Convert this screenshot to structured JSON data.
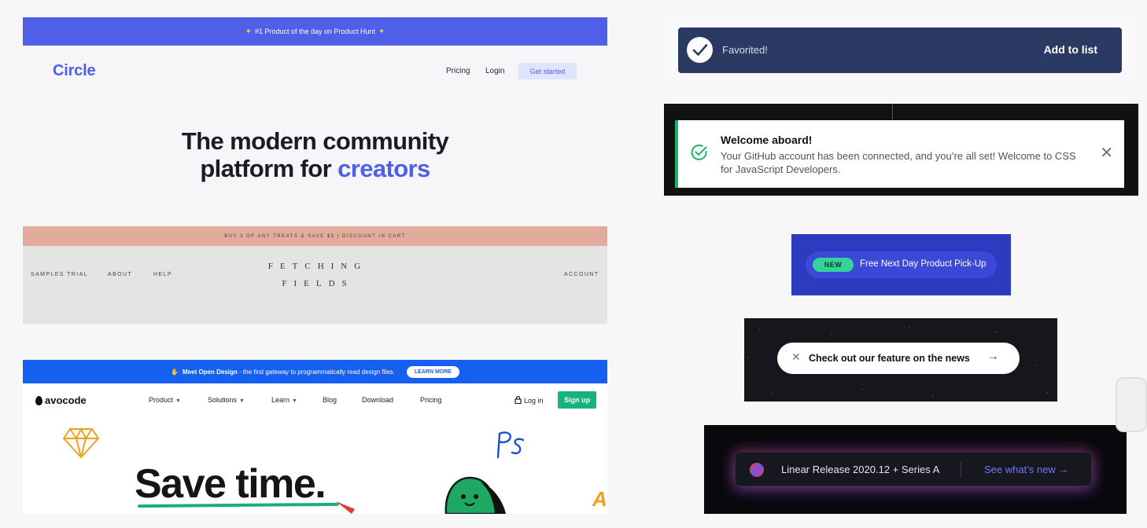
{
  "circle": {
    "banner": "#1 Product of the day on Product Hunt",
    "logo": "Circle",
    "nav": [
      "Pricing",
      "Login"
    ],
    "cta": "Get started",
    "hero_line1": "The modern community",
    "hero_line2_prefix": "platform for ",
    "hero_line2_accent": "creators",
    "colors": {
      "accent": "#4f5fe8"
    }
  },
  "fetching": {
    "promo": "BUY 3 OF ANY TREATS & SAVE $5 | DISCOUNT IN CART",
    "nav_left": [
      "SAMPLES TRIAL",
      "ABOUT",
      "HELP"
    ],
    "brand_line1": "FETCHING",
    "brand_line2": "FIELDS",
    "nav_right": "ACCOUNT"
  },
  "avocode": {
    "topbar_lead": "Meet Open Design",
    "topbar_rest": " - the first gateway to programmatically read design files.",
    "learn_more": "LEARN MORE",
    "logo": "avocode",
    "nav": [
      {
        "label": "Product",
        "dropdown": true
      },
      {
        "label": "Solutions",
        "dropdown": true
      },
      {
        "label": "Learn",
        "dropdown": true
      },
      {
        "label": "Blog",
        "dropdown": false
      },
      {
        "label": "Download",
        "dropdown": false
      },
      {
        "label": "Pricing",
        "dropdown": false
      }
    ],
    "login": "Log in",
    "signup": "Sign up",
    "hero": "Save time.",
    "colors": {
      "brand": "#1560f0",
      "signup": "#16b47a"
    }
  },
  "favorited": {
    "text": "Favorited!",
    "action": "Add to list"
  },
  "github": {
    "title": "Welcome aboard!",
    "message": "Your GitHub account has been connected, and you’re all set! Welcome to CSS for JavaScript Developers."
  },
  "pickup": {
    "badge": "NEW",
    "text": "Free Next Day Product Pick-Up"
  },
  "news": {
    "text": "Check out our feature on the news"
  },
  "linear": {
    "release": "Linear Release 2020.12 + Series A",
    "link": "See what’s new →"
  }
}
